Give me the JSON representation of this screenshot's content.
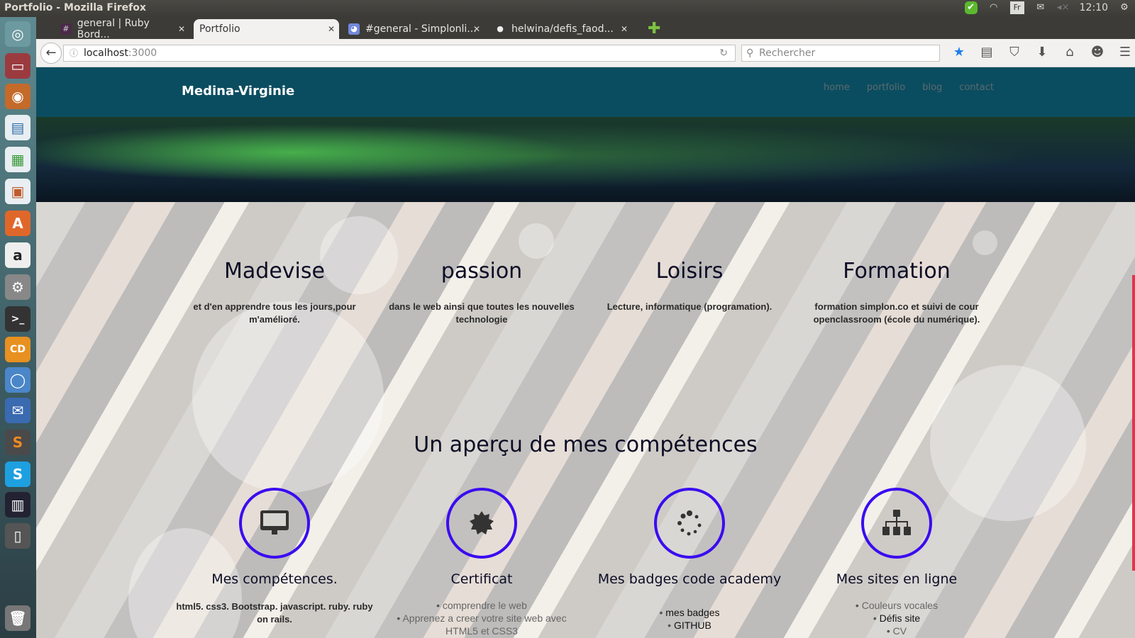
{
  "window": {
    "title": "Portfolio - Mozilla Firefox",
    "time": "12:10",
    "lang": "Fr"
  },
  "tabs": [
    {
      "label": "general | Ruby Bord...",
      "icon": "hash-icon"
    },
    {
      "label": "Portfolio",
      "icon": ""
    },
    {
      "label": "#general - Simplonli...",
      "icon": "discord-icon"
    },
    {
      "label": "helwina/defis_faod...",
      "icon": "github-icon"
    }
  ],
  "nav": {
    "url_host": "localhost",
    "url_port": ":3000",
    "search_placeholder": "Rechercher"
  },
  "site": {
    "brand": "Medina-Virginie",
    "menu": [
      "home",
      "portfolio",
      "blog",
      "contact"
    ],
    "intro": [
      {
        "title": "Madevise",
        "text": "et d'en apprendre tous les jours,pour m'amélioré."
      },
      {
        "title": "passion",
        "text": "dans le web ainsi que toutes les nouvelles technologie"
      },
      {
        "title": "Loisirs",
        "text": "Lecture, informatique (programation)."
      },
      {
        "title": "Formation",
        "text": "formation simplon.co et suivi de cour openclassroom (école du numérique)."
      }
    ],
    "skills_title": "Un aperçu de mes compétences",
    "skills": [
      {
        "title": "Mes compétences.",
        "text": "html5. css3. Bootstrap. javascript. ruby. ruby on rails.",
        "icon": "desktop-icon"
      },
      {
        "title": "Certificat",
        "items": [
          "comprendre le web",
          "Apprenez a creer votre site web avec HTML5 et CSS3"
        ],
        "icon": "certificate-icon"
      },
      {
        "title": "Mes badges code academy",
        "items": [
          "mes badges",
          "GITHUB"
        ],
        "icon": "spinner-icon"
      },
      {
        "title": "Mes sites en ligne",
        "items": [
          "Couleurs vocales",
          "Défis site",
          "CV"
        ],
        "icon": "sitemap-icon"
      }
    ]
  },
  "colors": {
    "header": "#0b4d60",
    "circle": "#3a0cf0",
    "scrollbar": "#e4344b"
  }
}
